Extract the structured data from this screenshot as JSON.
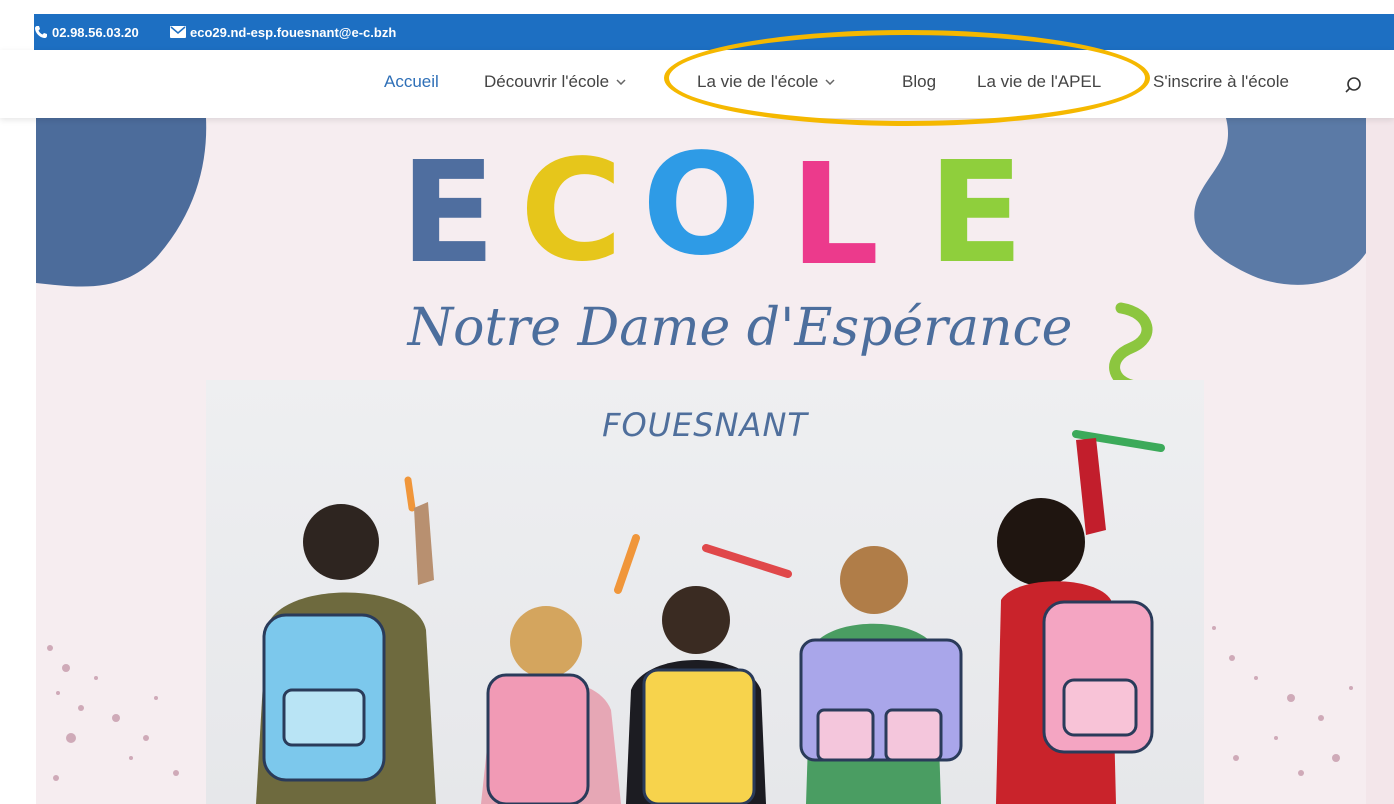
{
  "topbar": {
    "phone": "02.98.56.03.20",
    "email": "eco29.nd-esp.fouesnant@e-c.bzh",
    "color": "#1d6fc2"
  },
  "nav": {
    "items": [
      {
        "label": "Accueil",
        "active": true
      },
      {
        "label": "Découvrir l'école",
        "dropdown": true
      },
      {
        "label": "La vie de l'école",
        "dropdown": true
      },
      {
        "label": "Blog"
      },
      {
        "label": "La vie de l'APEL"
      },
      {
        "label": "S'inscrire à l'école"
      }
    ],
    "search_icon": "search-icon",
    "active_color": "#2e6fb7",
    "highlight_color": "#f5b800"
  },
  "hero": {
    "title_letters": [
      "E",
      "C",
      "O",
      "L",
      "E"
    ],
    "letter_colors": [
      "#4f6e9f",
      "#e6c61b",
      "#2e9be6",
      "#ec3a8c",
      "#8fcf3c"
    ],
    "subtitle": "Notre Dame d'Espérance",
    "city": "FOUESNANT"
  }
}
